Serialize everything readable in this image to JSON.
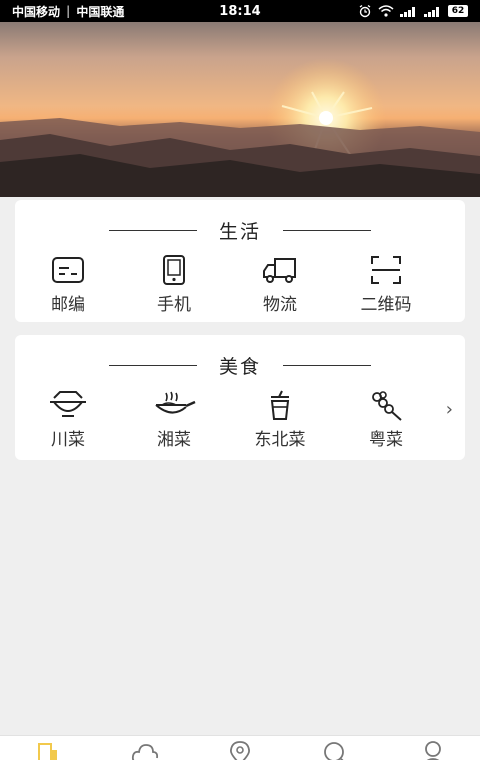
{
  "status_bar": {
    "carrier1": "中国移动",
    "carrier2": "中国联通",
    "time": "18:14",
    "battery": "62"
  },
  "life": {
    "title": "生活",
    "items": [
      {
        "label": "邮编",
        "icon": "postcode-icon"
      },
      {
        "label": "手机",
        "icon": "phone-icon"
      },
      {
        "label": "物流",
        "icon": "truck-icon"
      },
      {
        "label": "二维码",
        "icon": "qrcode-scan-icon"
      }
    ]
  },
  "food": {
    "title": "美食",
    "items": [
      {
        "label": "川菜",
        "icon": "hotpot-icon"
      },
      {
        "label": "湘菜",
        "icon": "wok-icon"
      },
      {
        "label": "东北菜",
        "icon": "drink-cup-icon"
      },
      {
        "label": "粤菜",
        "icon": "skewer-icon"
      }
    ]
  },
  "tabbar": {
    "tabs": [
      "home-icon",
      "weather-icon",
      "location-icon",
      "search-icon",
      "user-icon"
    ]
  },
  "colors": {
    "accent": "#f2c94c",
    "background": "#efefef",
    "card": "#ffffff"
  }
}
